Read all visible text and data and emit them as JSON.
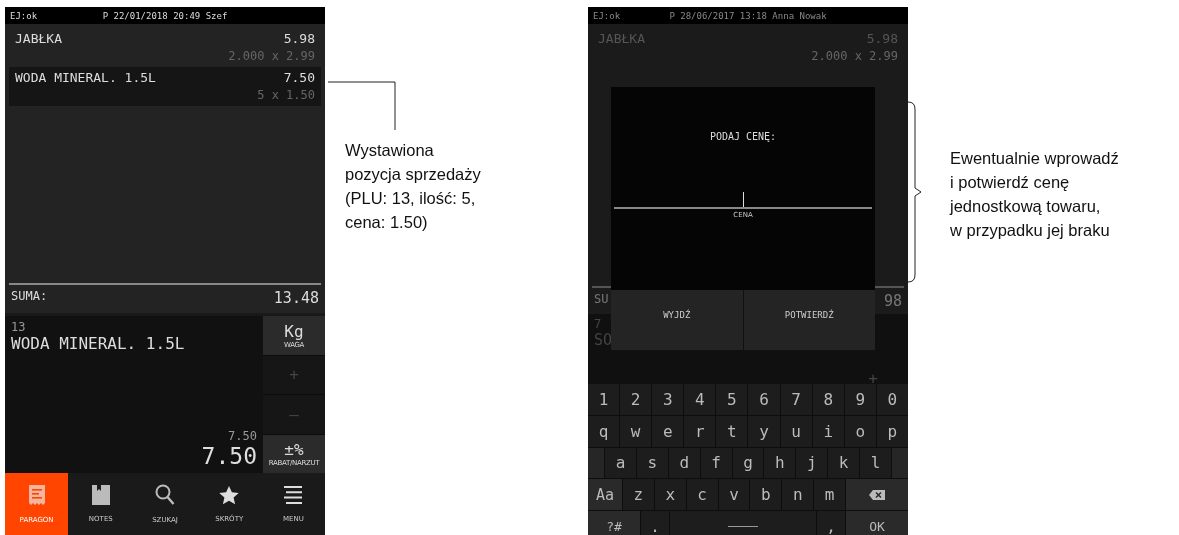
{
  "left_screen": {
    "status_bar": {
      "left": "EJ:ok",
      "center": "P 22/01/2018 20:49 Szef"
    },
    "receipt_items": [
      {
        "name": "JABŁKA",
        "total": "5.98",
        "detail": "2.000 x 2.99",
        "selected": false
      },
      {
        "name": "WODA MINERAL. 1.5L",
        "total": "7.50",
        "detail": "5 x 1.50",
        "selected": true
      }
    ],
    "total": {
      "label": "SUMA:",
      "value": "13.48"
    },
    "entry": {
      "plu": "13",
      "name": "WODA MINERAL. 1.5L",
      "unit_price": "7.50",
      "amount": "7.50"
    },
    "side_buttons": [
      {
        "symbol": "Kg",
        "label": "WAGA",
        "disabled": false
      },
      {
        "symbol": "+",
        "disabled": true
      },
      {
        "symbol": "—",
        "disabled": true
      },
      {
        "symbol": "±%",
        "label": "RABAT/NARZUT",
        "disabled": false
      }
    ],
    "nav_tabs": [
      {
        "kind": "receipt",
        "label": "PARAGON",
        "selected": true
      },
      {
        "kind": "notes",
        "label": "NOTES",
        "selected": false
      },
      {
        "kind": "search",
        "label": "SZUKAJ",
        "selected": false
      },
      {
        "kind": "star",
        "label": "SKRÓTY",
        "selected": false
      },
      {
        "kind": "menu",
        "label": "MENU",
        "selected": false
      }
    ]
  },
  "left_annotation": "Wystawiona\npozycja sprzedaży\n(PLU: 13, ilość: 5,\ncena: 1.50)",
  "right_screen": {
    "status_bar": {
      "left": "EJ:ok",
      "center": "P 28/06/2017 13:18 Anna Nowak"
    },
    "receipt_items": [
      {
        "name": "JABŁKA",
        "total": "5.98",
        "detail": "2.000 x 2.99"
      }
    ],
    "total": {
      "label": "SU",
      "value": "98"
    },
    "entry": {
      "plu": "7",
      "name": "SO",
      "symbol": "+"
    },
    "dialog": {
      "title": "PODAJ CENĘ:",
      "field_label": "CENA",
      "buttons": [
        "WYJDŹ",
        "POTWIERDŹ"
      ]
    },
    "keyboard": [
      {
        "indent": false,
        "keys": [
          {
            "kind": "char",
            "label": "1"
          },
          {
            "kind": "char",
            "label": "2"
          },
          {
            "kind": "char",
            "label": "3"
          },
          {
            "kind": "char",
            "label": "4"
          },
          {
            "kind": "char",
            "label": "5"
          },
          {
            "kind": "char",
            "label": "6"
          },
          {
            "kind": "char",
            "label": "7"
          },
          {
            "kind": "char",
            "label": "8"
          },
          {
            "kind": "char",
            "label": "9"
          },
          {
            "kind": "char",
            "label": "0"
          }
        ]
      },
      {
        "indent": false,
        "keys": [
          {
            "kind": "char",
            "label": "q"
          },
          {
            "kind": "char",
            "label": "w"
          },
          {
            "kind": "char",
            "label": "e"
          },
          {
            "kind": "char",
            "label": "r"
          },
          {
            "kind": "char",
            "label": "t"
          },
          {
            "kind": "char",
            "label": "y"
          },
          {
            "kind": "char",
            "label": "u"
          },
          {
            "kind": "char",
            "label": "i"
          },
          {
            "kind": "char",
            "label": "o"
          },
          {
            "kind": "char",
            "label": "p"
          }
        ]
      },
      {
        "indent": true,
        "keys": [
          {
            "kind": "char",
            "label": "a"
          },
          {
            "kind": "char",
            "label": "s"
          },
          {
            "kind": "char",
            "label": "d"
          },
          {
            "kind": "char",
            "label": "f"
          },
          {
            "kind": "char",
            "label": "g"
          },
          {
            "kind": "char",
            "label": "h"
          },
          {
            "kind": "char",
            "label": "j"
          },
          {
            "kind": "char",
            "label": "k"
          },
          {
            "kind": "char",
            "label": "l"
          }
        ]
      },
      {
        "indent": false,
        "keys": [
          {
            "kind": "shift",
            "label": "Aa"
          },
          {
            "kind": "char",
            "label": "z"
          },
          {
            "kind": "char",
            "label": "x"
          },
          {
            "kind": "char",
            "label": "c"
          },
          {
            "kind": "char",
            "label": "v"
          },
          {
            "kind": "char",
            "label": "b"
          },
          {
            "kind": "char",
            "label": "n"
          },
          {
            "kind": "char",
            "label": "m"
          },
          {
            "kind": "backspace"
          }
        ]
      },
      {
        "indent": false,
        "keys": [
          {
            "kind": "symbols",
            "label": "?#"
          },
          {
            "kind": "char",
            "label": "."
          },
          {
            "kind": "space"
          },
          {
            "kind": "char",
            "label": ","
          },
          {
            "kind": "enter",
            "label": "OK"
          }
        ]
      }
    ]
  },
  "right_annotation": "Ewentualnie wprowadź\ni potwierdź cenę\njednostkową towaru,\nw przypadku jej braku"
}
